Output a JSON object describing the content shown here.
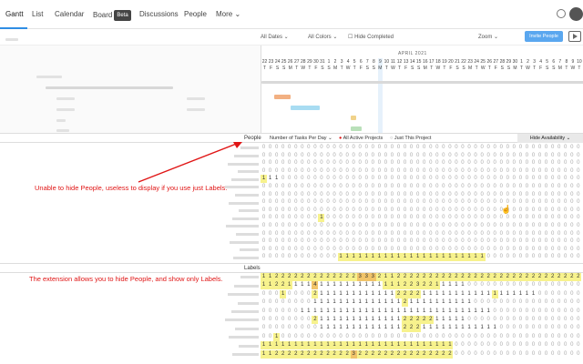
{
  "nav": {
    "tabs": [
      {
        "label": "Gantt",
        "active": true
      },
      {
        "label": "List"
      },
      {
        "label": "Calendar"
      },
      {
        "label": "Board"
      },
      {
        "label": "Discussions"
      },
      {
        "label": "People"
      },
      {
        "label": "More"
      }
    ],
    "beta_badge": "Beta"
  },
  "filters": {
    "dates": "All Dates",
    "colors": "All Colors",
    "hide_completed": "Hide Completed",
    "zoom": "Zoom",
    "invite": "Invite People"
  },
  "timeline": {
    "month": "APRIL 2021",
    "days": [
      "22",
      "23",
      "24",
      "25",
      "26",
      "27",
      "28",
      "29",
      "30",
      "31",
      "1",
      "2",
      "3",
      "4",
      "5",
      "6",
      "7",
      "8",
      "9",
      "10",
      "11",
      "12",
      "13",
      "14",
      "15",
      "16",
      "17",
      "18",
      "19",
      "20",
      "21",
      "22",
      "23",
      "24",
      "25",
      "26",
      "27",
      "28",
      "29",
      "30",
      "1",
      "2",
      "3",
      "4",
      "5",
      "6",
      "7",
      "8",
      "9",
      "10"
    ],
    "weekdays": [
      "T",
      "F",
      "S",
      "S",
      "M",
      "T",
      "W",
      "T",
      "F",
      "S",
      "S",
      "M",
      "T",
      "W",
      "T",
      "F",
      "S",
      "S",
      "M",
      "T",
      "W",
      "T",
      "F",
      "S",
      "S",
      "M",
      "T",
      "W",
      "T",
      "F",
      "S",
      "S",
      "M",
      "T",
      "W",
      "T",
      "F",
      "S",
      "S",
      "M",
      "T",
      "W",
      "T",
      "F",
      "S",
      "S",
      "M",
      "T",
      "W",
      "T"
    ]
  },
  "people_section": {
    "title": "People",
    "metric": "Number of Tasks Per Day",
    "scope_all": "All Active Projects",
    "scope_this": "Just This Project",
    "hide_availability": "Hide Availability",
    "annotation": "Unable to hide People, useless to display if you use just Labels."
  },
  "labels_section": {
    "title": "Labels",
    "annotation": "The extension allows you to hide People, and show only Labels."
  },
  "people_rows": [
    {
      "cells": {}
    },
    {
      "cells": {}
    },
    {
      "cells": {}
    },
    {
      "cells": {}
    },
    {
      "cells": {
        "0": "1",
        "1": "1",
        "2": "1"
      },
      "yellow": [
        0
      ]
    },
    {
      "cells": {}
    },
    {
      "cells": {}
    },
    {
      "cells": {}
    },
    {
      "cells": {}
    },
    {
      "cells": {
        "9": "1"
      },
      "yellow": [
        9
      ]
    },
    {
      "cells": {}
    },
    {
      "cells": {}
    },
    {
      "cells": {}
    },
    {
      "cells": {}
    },
    {
      "cells": {
        "12": "1",
        "13": "1",
        "14": "1",
        "15": "1",
        "16": "1",
        "17": "1",
        "18": "1",
        "19": "1",
        "20": "1",
        "21": "1",
        "22": "1",
        "23": "1",
        "24": "1",
        "25": "1",
        "26": "1",
        "27": "1",
        "28": "1",
        "29": "1",
        "30": "1",
        "31": "1",
        "32": "1",
        "33": "1",
        "34": "1"
      },
      "yellow": [
        12,
        13,
        14,
        15,
        16,
        17,
        18,
        19,
        20,
        21,
        22,
        23,
        24,
        25,
        26,
        27,
        28,
        29,
        30,
        31,
        32,
        33,
        34
      ]
    }
  ],
  "label_rows": [
    {
      "cells": {
        "0": "1",
        "1": "1",
        "2": "2",
        "3": "2",
        "4": "2",
        "5": "2",
        "6": "2",
        "7": "2",
        "8": "2",
        "9": "2",
        "10": "2",
        "11": "2",
        "12": "2",
        "13": "2",
        "14": "2",
        "15": "3",
        "16": "3",
        "17": "3",
        "18": "2",
        "19": "1",
        "20": "1",
        "21": "2",
        "22": "2",
        "23": "2",
        "24": "2",
        "25": "2",
        "26": "2",
        "27": "2",
        "28": "2",
        "29": "2",
        "30": "2",
        "31": "2",
        "32": "2",
        "33": "2",
        "34": "2",
        "35": "2",
        "36": "2",
        "37": "2",
        "38": "2",
        "39": "2",
        "40": "2",
        "41": "2",
        "42": "2",
        "43": "2",
        "44": "2",
        "45": "2",
        "46": "2",
        "47": "2",
        "48": "2",
        "49": "2"
      },
      "yellow": [
        0,
        1,
        2,
        3,
        4,
        5,
        6,
        7,
        8,
        9,
        10,
        11,
        12,
        13,
        14,
        15,
        16,
        17,
        18,
        19,
        20,
        21,
        22,
        23,
        24,
        25,
        26,
        27,
        28,
        29,
        30,
        31,
        32,
        33,
        34,
        35,
        36,
        37,
        38,
        39,
        40,
        41,
        42,
        43,
        44,
        45,
        46,
        47,
        48,
        49
      ],
      "orange": [
        15,
        16,
        17
      ]
    },
    {
      "cells": {
        "0": "1",
        "1": "1",
        "2": "2",
        "3": "2",
        "4": "1",
        "5": "1",
        "6": "1",
        "7": "1",
        "8": "4",
        "9": "1",
        "10": "1",
        "11": "1",
        "12": "1",
        "13": "1",
        "14": "1",
        "15": "1",
        "16": "1",
        "17": "1",
        "18": "1",
        "19": "1",
        "20": "1",
        "21": "1",
        "22": "2",
        "23": "2",
        "24": "3",
        "25": "2",
        "26": "2",
        "27": "1",
        "28": "1",
        "29": "1",
        "30": "1",
        "31": "1"
      },
      "yellow": [
        0,
        1,
        2,
        3,
        4,
        8,
        19,
        20,
        21,
        22,
        23,
        24,
        25,
        26,
        27
      ],
      "orange": [
        8
      ]
    },
    {
      "cells": {
        "3": "1",
        "8": "2",
        "9": "1",
        "10": "1",
        "11": "1",
        "12": "1",
        "13": "1",
        "14": "1",
        "15": "1",
        "16": "1",
        "17": "1",
        "18": "1",
        "19": "1",
        "20": "1",
        "21": "2",
        "22": "2",
        "23": "2",
        "24": "2",
        "25": "1",
        "26": "1",
        "27": "1",
        "28": "1",
        "29": "1",
        "30": "1",
        "31": "1",
        "32": "1",
        "33": "1",
        "34": "1",
        "35": "1",
        "36": "1",
        "37": "1",
        "38": "1",
        "39": "1",
        "40": "1",
        "41": "1",
        "42": "1"
      },
      "yellow": [
        3,
        8,
        21,
        22,
        23,
        24,
        36
      ]
    },
    {
      "cells": {
        "8": "1",
        "9": "1",
        "10": "1",
        "11": "1",
        "12": "1",
        "13": "1",
        "14": "1",
        "15": "1",
        "16": "1",
        "17": "1",
        "18": "1",
        "19": "1",
        "20": "1",
        "21": "1",
        "22": "2",
        "23": "1",
        "24": "1",
        "25": "1",
        "26": "1",
        "27": "1",
        "28": "1",
        "29": "1",
        "30": "1",
        "31": "1",
        "32": "1"
      },
      "yellow": [
        22
      ]
    },
    {
      "cells": {
        "6": "1",
        "7": "1",
        "8": "1",
        "9": "1",
        "10": "1",
        "11": "1",
        "12": "1",
        "13": "1",
        "14": "1",
        "15": "1",
        "16": "1",
        "17": "1",
        "18": "1",
        "19": "1",
        "20": "1",
        "21": "1",
        "22": "1",
        "23": "1",
        "24": "1",
        "25": "1",
        "26": "1",
        "27": "1",
        "28": "1",
        "29": "1",
        "30": "1",
        "31": "1",
        "32": "1",
        "33": "1",
        "34": "1",
        "35": "1"
      },
      "yellow": []
    },
    {
      "cells": {
        "8": "2",
        "9": "1",
        "10": "1",
        "11": "1",
        "12": "1",
        "13": "1",
        "14": "1",
        "15": "1",
        "16": "1",
        "17": "1",
        "18": "1",
        "19": "1",
        "20": "1",
        "21": "1",
        "22": "2",
        "23": "2",
        "24": "2",
        "25": "2",
        "26": "2",
        "27": "1",
        "28": "1",
        "29": "1",
        "30": "1",
        "31": "1"
      },
      "yellow": [
        8,
        22,
        23,
        24,
        25,
        26
      ]
    },
    {
      "cells": {
        "9": "1",
        "10": "1",
        "11": "1",
        "12": "1",
        "13": "1",
        "14": "1",
        "15": "1",
        "16": "1",
        "17": "1",
        "18": "1",
        "19": "1",
        "20": "1",
        "21": "1",
        "22": "2",
        "23": "2",
        "24": "2",
        "25": "1",
        "26": "1",
        "27": "1",
        "28": "1",
        "29": "1",
        "30": "1",
        "31": "1",
        "32": "1",
        "33": "1",
        "34": "1",
        "35": "1",
        "36": "1"
      },
      "yellow": [
        22,
        23,
        24
      ]
    },
    {
      "cells": {
        "2": "1"
      },
      "yellow": [
        2
      ]
    },
    {
      "cells": {
        "0": "1",
        "1": "1",
        "2": "1",
        "3": "1",
        "4": "1",
        "5": "1",
        "6": "1",
        "7": "1",
        "8": "1",
        "9": "1",
        "10": "1",
        "11": "1",
        "12": "1",
        "13": "1",
        "14": "1",
        "15": "1",
        "16": "1",
        "17": "1",
        "18": "1",
        "19": "1",
        "20": "1",
        "21": "1",
        "22": "1",
        "23": "1",
        "24": "1",
        "25": "1",
        "26": "1",
        "27": "1",
        "28": "1",
        "29": "1"
      },
      "yellow": [
        0,
        1,
        2,
        3,
        4,
        5,
        6,
        7,
        8,
        9,
        10,
        11,
        12,
        13,
        14,
        15,
        16,
        17,
        18,
        19,
        20,
        21,
        22,
        23,
        24,
        25,
        26,
        27,
        28,
        29
      ]
    },
    {
      "cells": {
        "0": "1",
        "1": "1",
        "2": "2",
        "3": "2",
        "4": "2",
        "5": "2",
        "6": "2",
        "7": "2",
        "8": "2",
        "9": "2",
        "10": "2",
        "11": "2",
        "12": "2",
        "13": "2",
        "14": "3",
        "15": "2",
        "16": "2",
        "17": "2",
        "18": "2",
        "19": "2",
        "20": "2",
        "21": "2",
        "22": "2",
        "23": "2",
        "24": "2",
        "25": "2",
        "26": "2",
        "27": "2",
        "28": "2",
        "29": "2"
      },
      "yellow": [
        0,
        1,
        2,
        3,
        4,
        5,
        6,
        7,
        8,
        9,
        10,
        11,
        12,
        13,
        15,
        16,
        17,
        18,
        19,
        20,
        21,
        22,
        23,
        24,
        25,
        26,
        27,
        28,
        29
      ],
      "orange": [
        14
      ]
    }
  ],
  "colors": {
    "accent": "#2f8de4",
    "annotation": "#e01515",
    "heat_low": "#f7f28d",
    "heat_high": "#f1c46a",
    "invite_btn": "#5aa7ef"
  }
}
